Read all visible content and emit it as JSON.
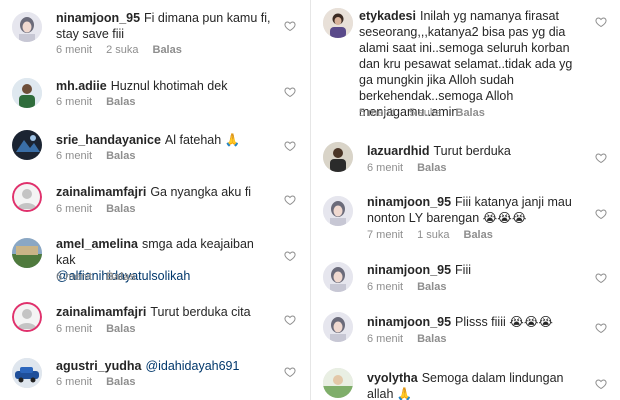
{
  "left": [
    {
      "user": "ninamjoon_95",
      "text": "Fi dimana pun kamu fi, stay save fiii",
      "time": "6 menit",
      "likes": "2 suka",
      "reply": "Balas",
      "avatar": "girl-avatar"
    },
    {
      "user": "mh.adiie",
      "text": "Huznul khotimah dek",
      "time": "6 menit",
      "likes": "",
      "reply": "Balas",
      "avatar": "person-avatar"
    },
    {
      "user": "srie_handayanice",
      "text": "Al fatehah 🙏",
      "time": "6 menit",
      "likes": "",
      "reply": "Balas",
      "avatar": "dark-avatar"
    },
    {
      "user": "zainalimamfajri",
      "text": "Ga nyangka aku fi",
      "time": "6 menit",
      "likes": "",
      "reply": "Balas",
      "avatar": "default-avatar"
    },
    {
      "user": "amel_amelina",
      "text": "smga ada keajaiban kak",
      "mention": "@alfianihidayatulsolikah",
      "time": "6 menit",
      "likes": "",
      "reply": "Balas",
      "avatar": "photo-avatar"
    },
    {
      "user": "zainalimamfajri",
      "text": "Turut berduka cita",
      "time": "6 menit",
      "likes": "",
      "reply": "Balas",
      "avatar": "default-avatar"
    },
    {
      "user": "agustri_yudha",
      "text": "",
      "mention": "@idahidayah691",
      "time": "6 menit",
      "likes": "",
      "reply": "Balas",
      "avatar": "car-avatar"
    }
  ],
  "right": [
    {
      "user": "etykadesi",
      "text": "Inilah yg namanya firasat seseorang,,,katanya2 bisa pas yg dia alami saat ini..semoga seluruh korban dan kru pesawat selamat..tidak ada yg ga mungkin jika Alloh sudah berkehendak..semoga Alloh menjagamu..amin",
      "time": "5 menit",
      "likes": "5 suka",
      "reply": "Balas",
      "avatar": "person-avatar"
    },
    {
      "user": "lazuardhid",
      "text": "Turut berduka",
      "time": "6 menit",
      "likes": "",
      "reply": "Balas",
      "avatar": "person-avatar"
    },
    {
      "user": "ninamjoon_95",
      "text": "Fiii katanya janji mau nonton LY barengan 😭😭😭",
      "time": "7 menit",
      "likes": "1 suka",
      "reply": "Balas",
      "avatar": "girl-avatar"
    },
    {
      "user": "ninamjoon_95",
      "text": "Fiii",
      "time": "6 menit",
      "likes": "",
      "reply": "Balas",
      "avatar": "girl-avatar"
    },
    {
      "user": "ninamjoon_95",
      "text": "Plisss fiiii 😭😭😭",
      "time": "6 menit",
      "likes": "",
      "reply": "Balas",
      "avatar": "girl-avatar"
    },
    {
      "user": "vyolytha",
      "text": "Semoga dalam lindungan allah 🙏",
      "time": "",
      "likes": "",
      "reply": "",
      "avatar": "photo-avatar"
    }
  ]
}
